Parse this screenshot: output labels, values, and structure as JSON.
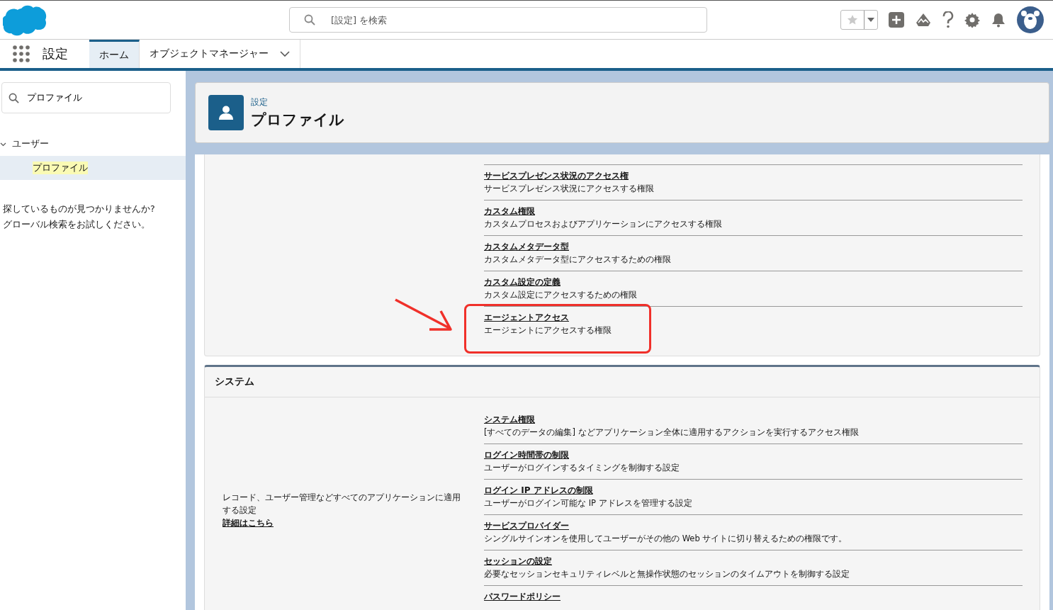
{
  "header": {
    "search": {
      "placeholder": "[設定] を検索"
    }
  },
  "nav": {
    "app_name": "設定",
    "tabs": [
      {
        "label": "ホーム",
        "selected": true,
        "dropdown": false
      },
      {
        "label": "オブジェクトマネージャー",
        "selected": false,
        "dropdown": true
      }
    ]
  },
  "sidebar": {
    "search": {
      "value": "プロファイル"
    },
    "tree": [
      {
        "label": "ユーザー",
        "expanded": true,
        "children": [
          {
            "label": "プロファイル",
            "selected": true
          }
        ]
      }
    ],
    "hint": [
      "探しているものが見つかりませんか?",
      "グローバル検索をお試しください。"
    ]
  },
  "page_header": {
    "breadcrumb": "設定",
    "title": "プロファイル"
  },
  "sections": [
    {
      "items": [
        {
          "title": "サービスプレゼンス状況のアクセス権",
          "text": "サービスプレゼンス状況にアクセスする権限",
          "highlighted": false
        },
        {
          "title": "カスタム権限",
          "text": "カスタムプロセスおよびアプリケーションにアクセスする権限",
          "highlighted": false
        },
        {
          "title": "カスタムメタデータ型",
          "text": "カスタムメタデータ型にアクセスするための権限",
          "highlighted": false
        },
        {
          "title": "カスタム設定の定義",
          "text": "カスタム設定にアクセスするための権限",
          "highlighted": false
        },
        {
          "title": "エージェントアクセス",
          "text": "エージェントにアクセスする権限",
          "highlighted": true
        }
      ]
    },
    {
      "title": "システム",
      "description": "レコード、ユーザー管理などすべてのアプリケーションに適用する設定",
      "link": "詳細はこちら",
      "items": [
        {
          "title": "システム権限",
          "text": "[すべてのデータの編集] などアプリケーション全体に適用するアクションを実行するアクセス権限",
          "highlighted": false
        },
        {
          "title": "ログイン時間帯の制限",
          "text": "ユーザーがログインするタイミングを制御する設定",
          "highlighted": false
        },
        {
          "title": "ログイン IP アドレスの制限",
          "text": "ユーザーがログイン可能な IP アドレスを管理する設定",
          "highlighted": false
        },
        {
          "title": "サービスプロバイダー",
          "text": "シングルサインオンを使用してユーザーがその他の Web サイトに切り替えるための権限です。",
          "highlighted": false
        },
        {
          "title": "セッションの設定",
          "text": "必要なセッションセキュリティレベルと無操作状態のセッションのタイムアウトを制御する設定",
          "highlighted": false
        },
        {
          "title": "パスワードポリシー",
          "highlighted": false
        }
      ]
    }
  ]
}
